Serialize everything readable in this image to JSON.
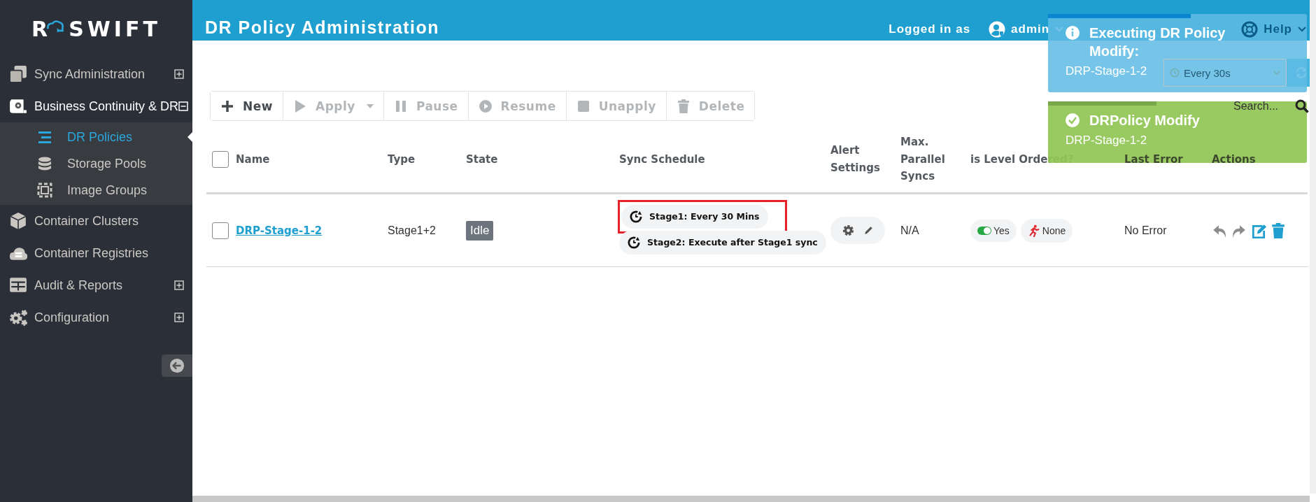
{
  "sidebar": {
    "logo": {
      "mark": "R",
      "name": "SWIFT"
    },
    "items": [
      {
        "kind": "group",
        "label": "Sync Administration",
        "expanded": false
      },
      {
        "kind": "group",
        "label": "Business Continuity & DR",
        "expanded": true,
        "children": [
          {
            "label": "DR Policies",
            "selected": true
          },
          {
            "label": "Storage Pools",
            "selected": false
          },
          {
            "label": "Image Groups",
            "selected": false
          }
        ]
      },
      {
        "kind": "link",
        "label": "Container Clusters"
      },
      {
        "kind": "link",
        "label": "Container Registries"
      },
      {
        "kind": "group",
        "label": "Audit & Reports",
        "expanded": false
      },
      {
        "kind": "group",
        "label": "Configuration",
        "expanded": false
      }
    ]
  },
  "header": {
    "title": "DR Policy Administration",
    "user_prefix": "Logged in as",
    "user": "admin",
    "help": "Help"
  },
  "refresh": {
    "interval": "Every 30s"
  },
  "search": {
    "placeholder": "Search..."
  },
  "toolbar": [
    {
      "label": "New",
      "kind": "plain",
      "disabled": false
    },
    {
      "label": "Apply",
      "kind": "split",
      "disabled": true
    },
    {
      "label": "Pause",
      "kind": "plain",
      "disabled": true
    },
    {
      "label": "Resume",
      "kind": "plain",
      "disabled": true
    },
    {
      "label": "Unapply",
      "kind": "plain",
      "disabled": true
    },
    {
      "label": "Delete",
      "kind": "plain",
      "disabled": true
    }
  ],
  "table": {
    "select_all": {
      "checked": false
    },
    "columns": [
      "Name",
      "Type",
      "State",
      "Sync Schedule",
      "Alert Settings",
      "Max. Parallel Syncs",
      "is Level Ordered?",
      "Last Error",
      "Actions"
    ],
    "rows": [
      {
        "checked": false,
        "name": "DRP-Stage-1-2",
        "type": "Stage1+2",
        "state": "Idle",
        "schedule": [
          {
            "text": "Stage1: Every 30 Mins",
            "highlighted": true
          },
          {
            "text": "Stage2: Execute after Stage1 sync",
            "highlighted": false
          }
        ],
        "max_parallel": "N/A",
        "level_ordered": {
          "on": true,
          "label": "Yes"
        },
        "mode": "None",
        "last_error": "No Error",
        "actions": [
          {
            "disabled": true
          },
          {
            "disabled": true
          },
          {
            "disabled": false
          },
          {
            "disabled": false
          }
        ]
      }
    ]
  },
  "toasts": [
    {
      "kind": "info",
      "title": "Executing DR Policy Modify:",
      "message": "DRP-Stage-1-2",
      "level": 0.55
    },
    {
      "kind": "success",
      "title": "DRPolicy Modify",
      "message": "DRP-Stage-1-2",
      "level": 0.42
    }
  ]
}
